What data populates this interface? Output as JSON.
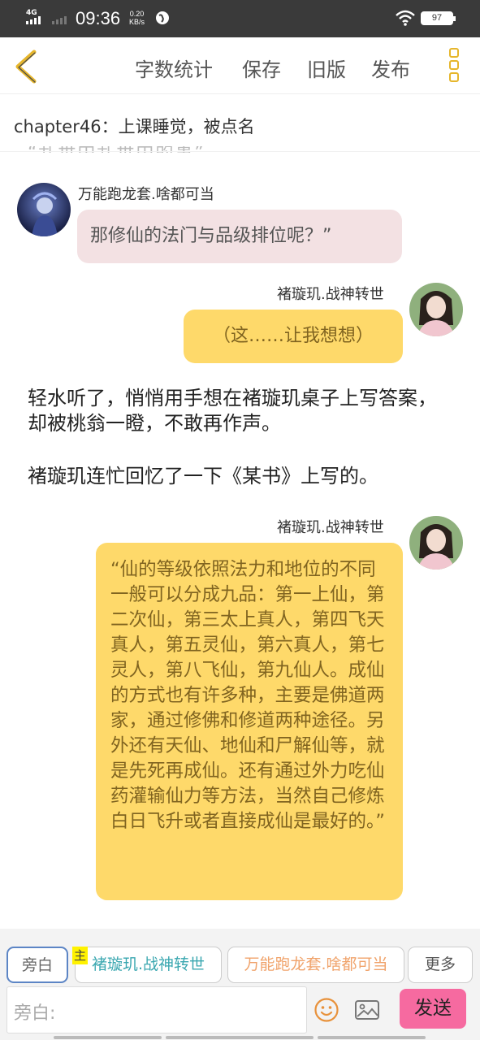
{
  "status_bar": {
    "network": "4G",
    "time": "09:36",
    "speed_value": "0.20",
    "speed_unit": "KB/s",
    "battery": "97"
  },
  "toolbar": {
    "word_count": "字数统计",
    "save": "保存",
    "old_version": "旧版",
    "publish": "发布"
  },
  "chapter_title": "chapter46：上课睡觉，被点名",
  "clipped_text": "“乱世中乱世中的事”",
  "messages": [
    {
      "type": "left",
      "name": "万能跑龙套.啥都可当",
      "text": "那修仙的法门与品级排位呢？”"
    },
    {
      "type": "right",
      "name": "褚璇玑.战神转世",
      "text": "（这……让我想想）"
    },
    {
      "type": "narration",
      "text": "轻水听了，悄悄用手想在褚璇玑桌子上写答案，却被桃翁一瞪，不敢再作声。"
    },
    {
      "type": "narration",
      "text": "褚璇玑连忙回忆了一下《某书》上写的。"
    },
    {
      "type": "right",
      "name": "褚璇玑.战神转世",
      "text": "“仙的等级依照法力和地位的不同一般可以分成九品：第一上仙，第二次仙，第三太上真人，第四飞天真人，第五灵仙，第六真人，第七灵人，第八飞仙，第九仙人。成仙的方式也有许多种，主要是佛道两家，通过修佛和修道两种途径。另外还有天仙、地仙和尸解仙等，就是先死再成仙。还有通过外力吃仙药灌输仙力等方法，当然自己修炼白日飞升或者直接成仙是最好的。”"
    }
  ],
  "roles": {
    "narration": "旁白",
    "main_tag": "主",
    "main": "褚璇玑.战神转世",
    "support": "万能跑龙套.啥都可当",
    "more": "更多"
  },
  "input": {
    "placeholder": "旁白:"
  },
  "send": "发送",
  "colors": {
    "accent_yellow": "#fed96a",
    "pink_bubble": "#f3e1e3",
    "send_button": "#f66aa0",
    "main_role": "#3aa7b0",
    "support_role": "#f0a36b"
  }
}
